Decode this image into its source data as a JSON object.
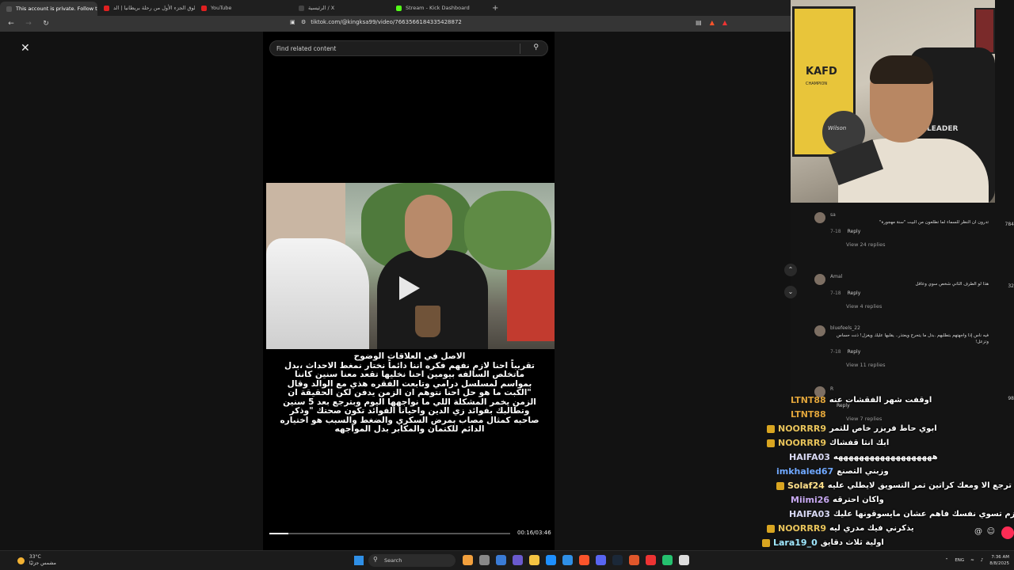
{
  "browser": {
    "tabs": [
      {
        "label": "This account is private. Follow th",
        "color": "#555555",
        "active": true
      },
      {
        "label": "طلوق الجزء الأول من رحلة بريطانيا | الد",
        "color": "#e02020",
        "active": false
      },
      {
        "label": "YouTube",
        "color": "#e02020",
        "active": false
      },
      {
        "label": "الرئيسية / X",
        "color": "#444444",
        "active": false
      },
      {
        "label": "Stream - Kick Dashboard",
        "color": "#53fc18",
        "active": false
      }
    ],
    "url": "tiktok.com/@kingksa99/video/7663566184335428872"
  },
  "tiktok": {
    "search_placeholder": "Find related content",
    "caption": "الاصل في العلاقات الوضوح\nتقريباً احنا لازم نفهم فكره اننا دائماً نختار نمغط الاحداث ،بدل ماتخلص السالفه بيومين احنا نخليها تقعد معنا سنين كاننا بمواسم لمسلسل درامي وتابعت الفقره هذي مع الوالد وقال \"الكبت ما هو حل احنا نتوهم ان الزمن يدفن لكن الحقيقة ان الزمن يخمر المشكلة اللي ما نواجهها اليوم وبترجع بعد 5 سنين وتطالبك بفوائد زي الدين واحيانا الفوائد تكون صحتك \"وذكر صاحبه كمثال مصاب بمرض السكري والضغط والسبب هو اختياره الدائم للكتمان والمكابر بدل المواجهه",
    "time": "00:16/03:46",
    "progress": 0.08
  },
  "webcam": {
    "jersey_text": "KAFD",
    "jersey_sub": "CHAMPION",
    "ball_text": "Wilson",
    "chair_text": "LEADER"
  },
  "comments": [
    {
      "user": "sa",
      "text": "تدرون ان النظر للسماء لما تطلعون من البيت \"سنة مهجورة\"",
      "date": "7-18",
      "reply": "Reply",
      "views": "View 24 replies",
      "likes": "784"
    },
    {
      "user": "Amal",
      "text": "هذا لو الطرف الثاني شخص سوي وعاقل",
      "date": "7-18",
      "reply": "Reply",
      "views": "View 4 replies",
      "likes": "32"
    },
    {
      "user": "bluefeels_22",
      "text": "فيه ناس إذا واجهتهم بتطلبهم .بدل ما يتحرج ويعتذر.. يقلبها عليك ويغزل! ذنت حساس وتزعل!",
      "date": "7-18",
      "reply": "Reply",
      "views": "View 11 replies",
      "likes": ""
    },
    {
      "user": "R",
      "text": "",
      "date": "",
      "reply": "Reply",
      "views": "View 7 replies",
      "likes": "98"
    }
  ],
  "chat": [
    {
      "name": "LTNT88",
      "color": "#e0a43a",
      "badge": false,
      "msg": "اوقفت شهر الفقشات عنه"
    },
    {
      "name": "LTNT88",
      "color": "#e0a43a",
      "badge": false,
      "msg": ""
    },
    {
      "name": "NOORRR9",
      "color": "#e8c35a",
      "badge": true,
      "msg": "ابوي حاط فريزر خاص للتمر"
    },
    {
      "name": "NOORRR9",
      "color": "#e8c35a",
      "badge": true,
      "msg": "ابك انثا قفشاك"
    },
    {
      "name": "HAIFA03",
      "color": "#d9d9f5",
      "badge": false,
      "msg": "هههههههههههههههههههه"
    },
    {
      "name": "imkhaled67",
      "color": "#6fa8ff",
      "badge": false,
      "msg": "وزبني التصنع"
    },
    {
      "name": "Solaf24",
      "color": "#ffe08a",
      "badge": true,
      "msg": "ماراح ترجع الا ومعك كراتين تمر التسويق لايطلي عليه"
    },
    {
      "name": "Miimi26",
      "color": "#c6a7f0",
      "badge": false,
      "msg": "واكان احترقه"
    },
    {
      "name": "HAIFA03",
      "color": "#d9d9f5",
      "badge": false,
      "msg": "لازم تسوي نفسك فاهم عشان مايسوقونها عليك"
    },
    {
      "name": "NOORRR9",
      "color": "#e8c35a",
      "badge": true,
      "msg": "يذكرني فيك مدري ليه"
    },
    {
      "name": "Lara19_0",
      "color": "#9fe8ff",
      "badge": true,
      "msg": "اولية ثلاث دقايق"
    }
  ],
  "taskbar": {
    "temp": "33°C",
    "weather": "مشمس جزئيًا",
    "search": "Search",
    "lang": "ENG",
    "time": "7:36 AM",
    "date": "8/8/2025"
  }
}
